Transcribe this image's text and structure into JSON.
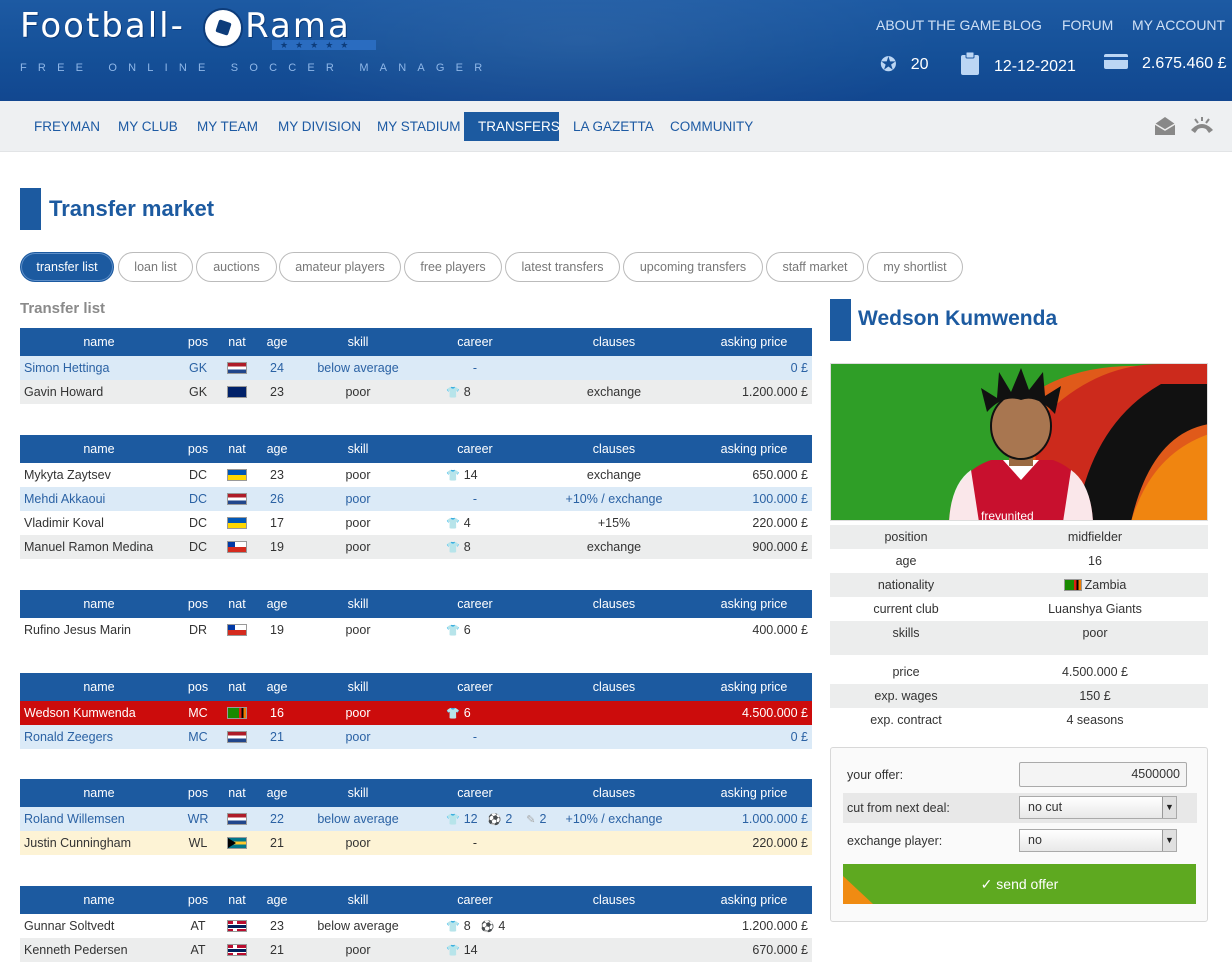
{
  "header": {
    "logo_text": "Football-⚽-Rama",
    "logo_left": "Football-",
    "logo_right": "-Rama",
    "tagline": "FREE ONLINE SOCCER MANAGER",
    "links": [
      "ABOUT THE GAME",
      "BLOG",
      "FORUM",
      "MY ACCOUNT"
    ],
    "stats": {
      "points": "20",
      "date": "12-12-2021",
      "money": "2.675.460 £"
    }
  },
  "nav": {
    "items": [
      "FREYMAN",
      "MY CLUB",
      "MY TEAM",
      "MY DIVISION",
      "MY STADIUM",
      "TRANSFERS",
      "LA GAZETTA",
      "COMMUNITY"
    ],
    "active": "TRANSFERS"
  },
  "page": {
    "title": "Transfer market",
    "section_title": "Transfer list"
  },
  "tabs": [
    "transfer list",
    "loan list",
    "auctions",
    "amateur players",
    "free players",
    "latest transfers",
    "upcoming transfers",
    "staff market",
    "my shortlist"
  ],
  "table_headers": [
    "name",
    "pos",
    "nat",
    "age",
    "skill",
    "career",
    "clauses",
    "asking price"
  ],
  "tables": [
    {
      "rows": [
        {
          "name": "Simon Hettinga",
          "pos": "GK",
          "nat": "nl",
          "age": "24",
          "skill": "below average",
          "career": "-",
          "clauses": "",
          "price": "0 £",
          "style": "blue"
        },
        {
          "name": "Gavin Howard",
          "pos": "GK",
          "nat": "au",
          "age": "23",
          "skill": "poor",
          "career_shirt": "8",
          "clauses": "exchange",
          "price": "1.200.000 £",
          "style": "gray"
        }
      ]
    },
    {
      "rows": [
        {
          "name": "Mykyta Zaytsev",
          "pos": "DC",
          "nat": "ua",
          "age": "23",
          "skill": "poor",
          "career_shirt": "14",
          "clauses": "exchange",
          "price": "650.000 £",
          "style": "white"
        },
        {
          "name": "Mehdi Akkaoui",
          "pos": "DC",
          "nat": "nl",
          "age": "26",
          "skill": "poor",
          "career": "-",
          "clauses": "+10% / exchange",
          "price": "100.000 £",
          "style": "blue"
        },
        {
          "name": "Vladimir Koval",
          "pos": "DC",
          "nat": "ua",
          "age": "17",
          "skill": "poor",
          "career_shirt": "4",
          "clauses": "+15%",
          "price": "220.000 £",
          "style": "white"
        },
        {
          "name": "Manuel Ramon Medina",
          "pos": "DC",
          "nat": "cl",
          "age": "19",
          "skill": "poor",
          "career_shirt": "8",
          "clauses": "exchange",
          "price": "900.000 £",
          "style": "gray"
        }
      ]
    },
    {
      "rows": [
        {
          "name": "Rufino Jesus Marin",
          "pos": "DR",
          "nat": "cl",
          "age": "19",
          "skill": "poor",
          "career_shirt": "6",
          "clauses": "",
          "price": "400.000 £",
          "style": "white"
        }
      ]
    },
    {
      "rows": [
        {
          "name": "Wedson Kumwenda",
          "pos": "MC",
          "nat": "zm",
          "age": "16",
          "skill": "poor",
          "career_shirt": "6",
          "clauses": "",
          "price": "4.500.000 £",
          "style": "red"
        },
        {
          "name": "Ronald Zeegers",
          "pos": "MC",
          "nat": "nl",
          "age": "21",
          "skill": "poor",
          "career": "-",
          "clauses": "",
          "price": "0 £",
          "style": "blue"
        }
      ]
    },
    {
      "rows": [
        {
          "name": "Roland Willemsen",
          "pos": "WR",
          "nat": "nl",
          "age": "22",
          "skill": "below average",
          "career_shirt": "12",
          "career_ball": "2",
          "career_pen": "2",
          "clauses": "+10% / exchange",
          "price": "1.000.000 £",
          "style": "blue"
        },
        {
          "name": "Justin Cunningham",
          "pos": "WL",
          "nat": "bs",
          "age": "21",
          "skill": "poor",
          "career": "-",
          "clauses": "",
          "price": "220.000 £",
          "style": "yellow"
        }
      ]
    },
    {
      "rows": [
        {
          "name": "Gunnar Soltvedt",
          "pos": "AT",
          "nat": "no",
          "age": "23",
          "skill": "below average",
          "career_shirt": "8",
          "career_ball": "4",
          "clauses": "",
          "price": "1.200.000 £",
          "style": "white"
        },
        {
          "name": "Kenneth Pedersen",
          "pos": "AT",
          "nat": "no",
          "age": "21",
          "skill": "poor",
          "career_shirt": "14",
          "clauses": "",
          "price": "670.000 £",
          "style": "gray"
        }
      ]
    }
  ],
  "player": {
    "name": "Wedson Kumwenda",
    "shirt_text": "freyunited",
    "details": [
      {
        "k": "position",
        "v": "midfielder"
      },
      {
        "k": "age",
        "v": "16"
      },
      {
        "k": "nationality",
        "v": "Zambia",
        "flag": "zm"
      },
      {
        "k": "current club",
        "v": "Luanshya Giants"
      },
      {
        "k": "skills",
        "v": "poor"
      },
      {
        "k": "price",
        "v": "4.500.000 £"
      },
      {
        "k": "exp. wages",
        "v": "150 £"
      },
      {
        "k": "exp. contract",
        "v": "4 seasons"
      }
    ]
  },
  "offer": {
    "your_offer_label": "your offer:",
    "your_offer_value": "4500000",
    "cut_label": "cut from next deal:",
    "cut_value": "no cut",
    "exchange_label": "exchange player:",
    "exchange_value": "no",
    "send_label": "✓ send offer"
  },
  "colors": {
    "brand": "#1c5aa0",
    "highlight_red": "#cc0c0c",
    "send_green": "#5ea920"
  }
}
